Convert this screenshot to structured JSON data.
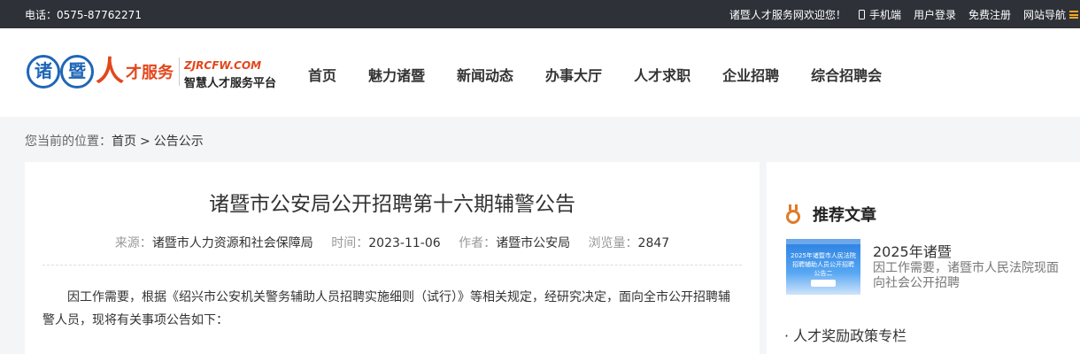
{
  "topbar": {
    "phone": "电话：0575-87762271",
    "welcome": "诸暨人才服务网欢迎您！",
    "mobile": "手机端",
    "login": "用户登录",
    "register": "免费注册",
    "sitenav": "网站导航"
  },
  "logo": {
    "char1": "诸",
    "char2": "暨",
    "ren": "人",
    "service": "才服务",
    "url": "ZJRCFW.COM",
    "subtitle": "智慧人才服务平台"
  },
  "nav": {
    "items": [
      "首页",
      "魅力诸暨",
      "新闻动态",
      "办事大厅",
      "人才求职",
      "企业招聘",
      "综合招聘会"
    ]
  },
  "breadcrumb": {
    "prefix": "您当前的位置：",
    "home": "首页",
    "separator": ">",
    "current": "公告公示"
  },
  "article": {
    "title": "诸暨市公安局公开招聘第十六期辅警公告",
    "source_label": "来源：",
    "source": "诸暨市人力资源和社会保障局",
    "time_label": "时间：",
    "time": "2023-11-06",
    "author_label": "作者：",
    "author": "诸暨市公安局",
    "views_label": "浏览量：",
    "views": "2847",
    "body": "因工作需要，根据《绍兴市公安机关警务辅助人员招聘实施细则（试行）》等相关规定，经研究决定，面向全市公开招聘辅警人员，现将有关事项公告如下："
  },
  "sidebar": {
    "heading": "推荐文章",
    "item": {
      "thumb_text": "2025年诸暨市人民法院招聘辅助人员公开招聘公告二",
      "title": "2025年诸暨",
      "desc": "因工作需要，诸暨市人民法院现面向社会公开招聘"
    },
    "link": "· 人才奖励政策专栏"
  },
  "colors": {
    "topbar_bg": "#2e3138",
    "brand_red": "#e3461b",
    "brand_blue": "#1f66b8",
    "accent_orange": "#e07b2a",
    "page_bg": "#f4f5f7"
  }
}
